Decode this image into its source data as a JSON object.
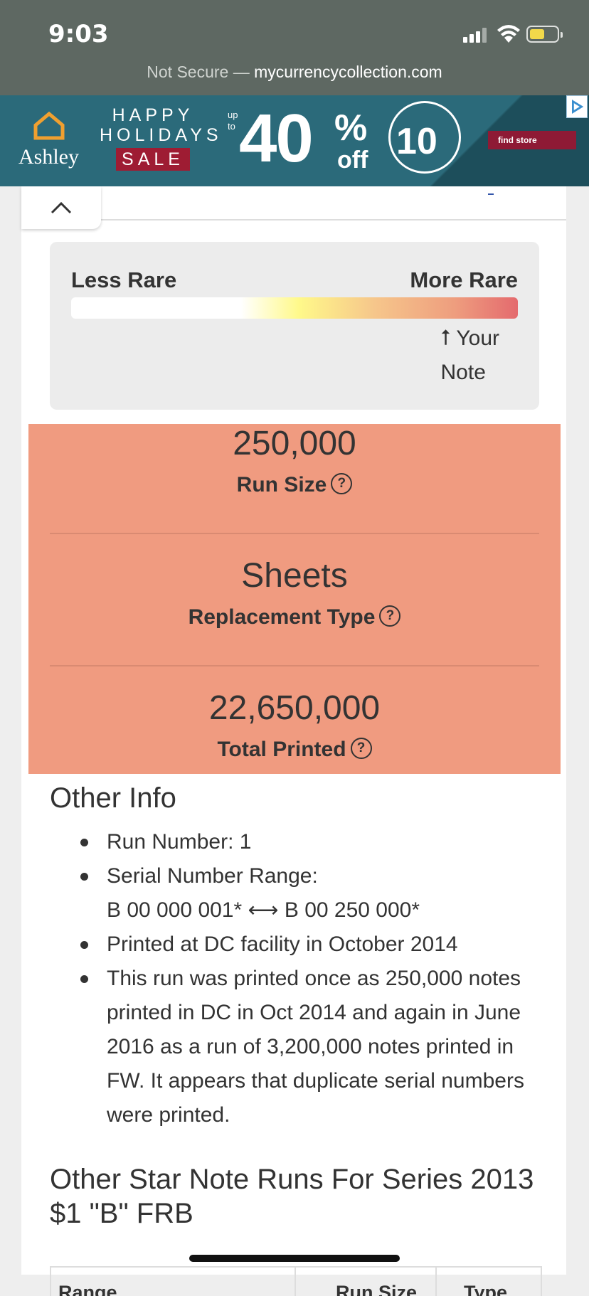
{
  "status_bar": {
    "time": "9:03"
  },
  "browser": {
    "not_secure": "Not Secure —",
    "domain": "mycurrencycollection.com"
  },
  "ad": {
    "brand": "Ashley",
    "happy_holidays": "HAPPY HOLIDAYS",
    "sale": "SALE",
    "up_to": "up to",
    "discount": "40",
    "percent": "%",
    "off": "off",
    "extra": "10",
    "cta": "find store"
  },
  "rarity": {
    "less_label": "Less Rare",
    "more_label": "More Rare",
    "your_note_line1": "Your",
    "your_note_line2": "Note",
    "arrow": "⭡",
    "level": 0.84
  },
  "stats": {
    "run_size_value": "250,000",
    "run_size_label": "Run Size",
    "replacement_value": "Sheets",
    "replacement_label": "Replacement Type",
    "total_value": "22,650,000",
    "total_label": "Total Printed",
    "help_glyph": "?"
  },
  "other_info": {
    "title": "Other Info",
    "run_number": "Run Number: 1",
    "serial_label": "Serial Number Range:",
    "serial_range": "B 00 000 001* ⟷ B 00 250 000*",
    "printed_at": "Printed at DC facility in October 2014",
    "note": "This run was printed once as 250,000 notes printed in DC in Oct 2014 and again in June 2016 as a run of 3,200,000 notes printed in FW. It appears that duplicate serial numbers were printed."
  },
  "runs": {
    "title": "Other Star Note Runs For Series 2013 $1 \"B\" FRB",
    "columns": [
      "Range",
      "Run Size",
      "Type"
    ]
  }
}
